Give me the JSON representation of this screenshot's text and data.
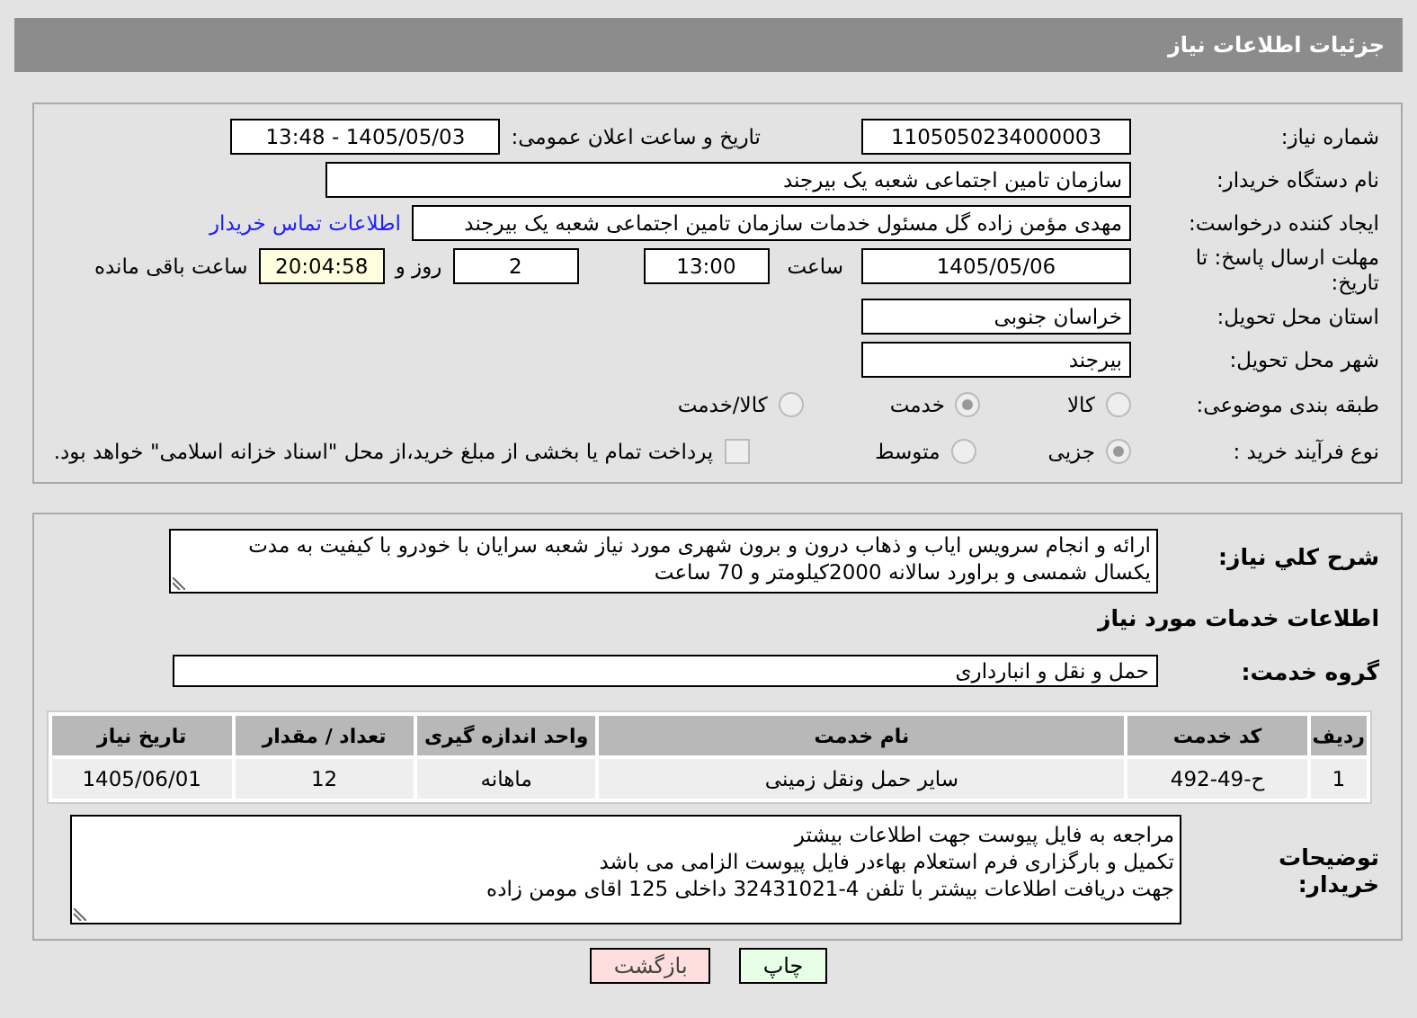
{
  "header": {
    "title": "جزئیات اطلاعات نیاز"
  },
  "need_info": {
    "need_number": {
      "label": "شماره نیاز:",
      "value": "1105050234000003"
    },
    "announce": {
      "label": "تاریخ و ساعت اعلان عمومی:",
      "value": "1405/05/03 - 13:48"
    },
    "buyer": {
      "label": "نام دستگاه خریدار:",
      "value": "سازمان تامین اجتماعی شعبه یک بیرجند"
    },
    "requester": {
      "label": "ایجاد کننده درخواست:",
      "value": "مهدی مؤمن زاده گل مسئول خدمات  سازمان تامین اجتماعی شعبه یک بیرجند",
      "link": "اطلاعات تماس خریدار"
    },
    "deadline": {
      "label": "مهلت ارسال پاسخ: تا تاریخ:",
      "date": "1405/05/06",
      "time_label": "ساعت",
      "time": "13:00",
      "days": "2",
      "days_label": "روز و",
      "remaining": "20:04:58",
      "remaining_label": "ساعت باقی مانده"
    },
    "province": {
      "label": "استان محل تحویل:",
      "value": "خراسان جنوبی"
    },
    "city": {
      "label": "شهر محل تحویل:",
      "value": "بیرجند"
    },
    "category": {
      "label": "طبقه بندی موضوعی:",
      "options": [
        {
          "label": "کالا",
          "selected": false
        },
        {
          "label": "خدمت",
          "selected": true
        },
        {
          "label": "کالا/خدمت",
          "selected": false
        }
      ]
    },
    "process": {
      "label": "نوع فرآیند خرید :",
      "options": [
        {
          "label": "جزیی",
          "selected": true
        },
        {
          "label": "متوسط",
          "selected": false
        }
      ],
      "payment": {
        "label": "پرداخت تمام یا بخشی از مبلغ خرید،از محل \"اسناد خزانه اسلامی\" خواهد بود.",
        "checked": false
      }
    }
  },
  "service_info": {
    "description": {
      "label": "شرح کلي نیاز:",
      "value": "ارائه و انجام سرویس اياب و ذهاب درون و برون شهری مورد نیاز شعبه  سرایان با خودرو با کیفیت به مدت یکسال شمسی و براورد سالانه 2000کیلومتر و 70 ساعت"
    },
    "section_title": "اطلاعات خدمات مورد نیاز",
    "group": {
      "label": "گروه خدمت:",
      "value": "حمل و نقل و انبارداری"
    },
    "table": {
      "columns": [
        "ردیف",
        "کد خدمت",
        "نام خدمت",
        "واحد اندازه گیری",
        "تعداد / مقدار",
        "تاریخ نیاز"
      ],
      "rows": [
        [
          "1",
          "ح-49-492",
          "سایر حمل ونقل زمینی",
          "ماهانه",
          "12",
          "1405/06/01"
        ]
      ]
    },
    "notes": {
      "label": "توضیحات خریدار:",
      "lines": [
        "مراجعه به فایل پیوست جهت اطلاعات بیشتر",
        "تکمیل و بارگزاری فرم استعلام بهاءدر فایل پیوست الزامی می باشد",
        "جهت دریافت اطلاعات بیشتر با تلفن 4-32431021 داخلی 125 اقای مومن زاده"
      ]
    }
  },
  "buttons": [
    {
      "label": "چاپ",
      "kind": "print"
    },
    {
      "label": "بازگشت",
      "kind": "back"
    }
  ]
}
